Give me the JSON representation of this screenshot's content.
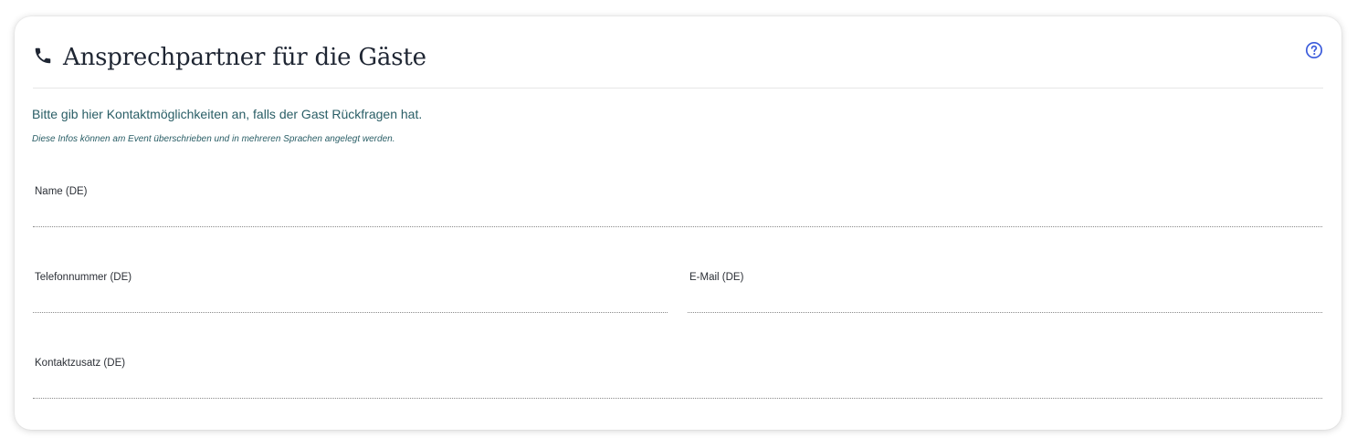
{
  "card": {
    "title": "Ansprechpartner für die Gäste",
    "title_icon": "phone-icon",
    "help_icon": "question-circle-icon",
    "hint": "Bitte gib hier Kontaktmöglichkeiten an, falls der Gast Rückfragen hat.",
    "subhint": "Diese Infos können am Event überschrieben und in mehreren Sprachen angelegt werden."
  },
  "form": {
    "name": {
      "label": "Name (DE)",
      "value": "",
      "placeholder": ""
    },
    "phone": {
      "label": "Telefonnummer (DE)",
      "value": "",
      "placeholder": ""
    },
    "email": {
      "label": "E-Mail (DE)",
      "value": "",
      "placeholder": ""
    },
    "extra": {
      "label": "Kontaktzusatz (DE)",
      "value": "",
      "placeholder": ""
    }
  },
  "colors": {
    "title": "#1f2633",
    "hint": "#2a5e66",
    "help_icon": "#3b5bdb"
  }
}
